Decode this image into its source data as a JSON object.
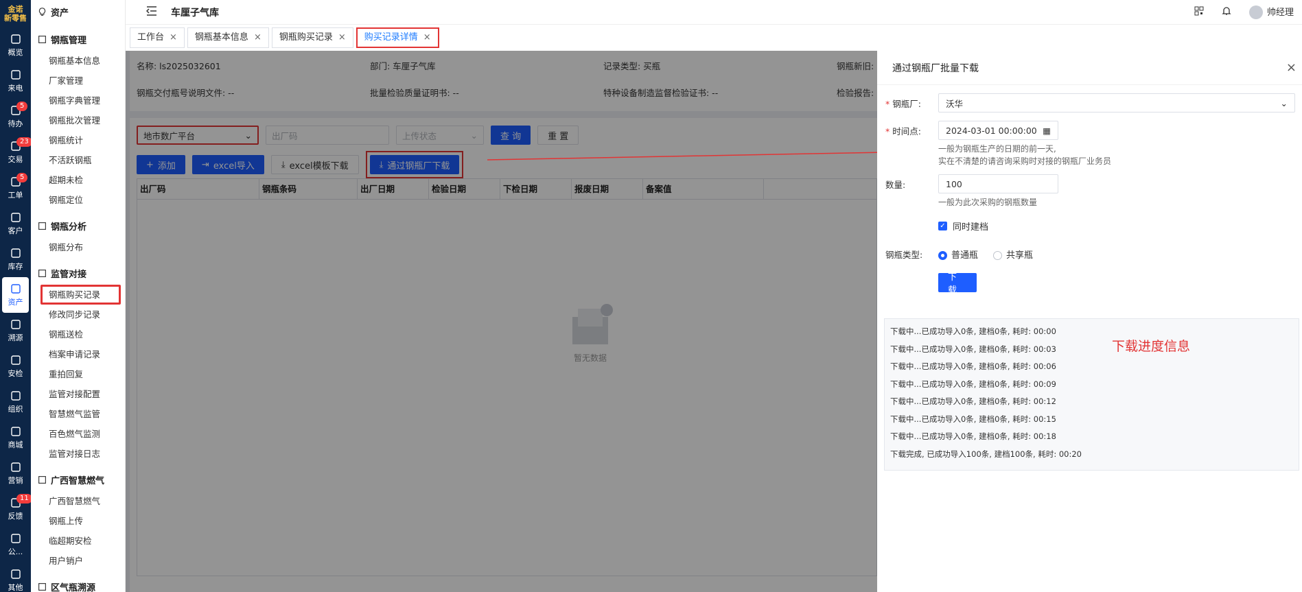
{
  "brand": {
    "line1": "金诺",
    "line2": "新零售"
  },
  "rail": [
    {
      "label": "概览",
      "icon": "chart-icon",
      "badge": ""
    },
    {
      "label": "来电",
      "icon": "phone-icon",
      "badge": ""
    },
    {
      "label": "待办",
      "icon": "todo-icon",
      "badge": "5"
    },
    {
      "label": "交易",
      "icon": "trade-icon",
      "badge": "23"
    },
    {
      "label": "工单",
      "icon": "ticket-icon",
      "badge": "5"
    },
    {
      "label": "客户",
      "icon": "customer-icon",
      "badge": ""
    },
    {
      "label": "库存",
      "icon": "inventory-icon",
      "badge": ""
    },
    {
      "label": "资产",
      "icon": "bulb-icon",
      "badge": "",
      "active": true
    },
    {
      "label": "溯源",
      "icon": "compass-icon",
      "badge": ""
    },
    {
      "label": "安检",
      "icon": "shield-icon",
      "badge": ""
    },
    {
      "label": "组织",
      "icon": "org-icon",
      "badge": ""
    },
    {
      "label": "商城",
      "icon": "shop-icon",
      "badge": ""
    },
    {
      "label": "营销",
      "icon": "trophy-icon",
      "badge": ""
    },
    {
      "label": "反馈",
      "icon": "feedback-icon",
      "badge": "11"
    },
    {
      "label": "公...",
      "icon": "megaphone-icon",
      "badge": ""
    },
    {
      "label": "其他",
      "icon": "grid-icon",
      "badge": ""
    }
  ],
  "sidebar": {
    "title": "资产",
    "sections": [
      {
        "title": "钢瓶管理",
        "items": [
          "钢瓶基本信息",
          "厂家管理",
          "钢瓶字典管理",
          "钢瓶批次管理",
          "钢瓶统计",
          "不活跃钢瓶",
          "超期未检",
          "钢瓶定位"
        ]
      },
      {
        "title": "钢瓶分析",
        "items": [
          "钢瓶分布"
        ]
      },
      {
        "title": "监管对接",
        "items": [
          "钢瓶购买记录",
          "修改同步记录",
          "钢瓶送检",
          "档案申请记录",
          "重拍回复",
          "监管对接配置",
          "智慧燃气监管",
          "百色燃气监测",
          "监管对接日志"
        ]
      },
      {
        "title": "广西智慧燃气",
        "items": [
          "广西智慧燃气",
          "钢瓶上传",
          "临超期安检",
          "用户销户"
        ]
      },
      {
        "title": "区气瓶溯源",
        "items": []
      }
    ]
  },
  "topbar": {
    "title": "车厘子气库",
    "user": "帅经理"
  },
  "tabs": [
    {
      "label": "工作台"
    },
    {
      "label": "钢瓶基本信息"
    },
    {
      "label": "钢瓶购买记录"
    },
    {
      "label": "购买记录详情",
      "active": true
    }
  ],
  "info": {
    "name": "名称: ls2025032601",
    "dept": "部门: 车厘子气库",
    "type": "记录类型: 买瓶",
    "new": "钢瓶新旧:",
    "file1": "钢瓶交付瓶号说明文件: --",
    "file2": "批量检验质量证明书: --",
    "file3": "特种设备制造监督检验证书: --",
    "file4": "检验报告:"
  },
  "filters": {
    "platform": "地市数广平台",
    "code_placeholder": "出厂码",
    "status_placeholder": "上传状态",
    "query": "查 询",
    "reset": "重 置"
  },
  "actions": {
    "add": "添加",
    "import": "excel导入",
    "template": "excel模板下载",
    "factory": "通过钢瓶厂下载"
  },
  "grid": {
    "columns": [
      "出厂码",
      "钢瓶条码",
      "出厂日期",
      "检验日期",
      "下检日期",
      "报废日期",
      "备案值"
    ],
    "empty": "暂无数据"
  },
  "drawer": {
    "title": "通过钢瓶厂批量下载",
    "factory_label": "钢瓶厂:",
    "factory_value": "沃华",
    "time_label": "时间点:",
    "time_value": "2024-03-01 00:00:00",
    "time_hint1": "一般为钢瓶生产的日期的前一天,",
    "time_hint2": "实在不清楚的请咨询采购时对接的钢瓶厂业务员",
    "qty_label": "数量:",
    "qty_value": "100",
    "qty_hint": "一般为此次采购的钢瓶数量",
    "archive_label": "同时建档",
    "type_label": "钢瓶类型:",
    "type_opt1": "普通瓶",
    "type_opt2": "共享瓶",
    "download": "下 载",
    "log": [
      "下载中...已成功导入0条, 建档0条, 耗时: 00:00",
      "下载中...已成功导入0条, 建档0条, 耗时: 00:03",
      "下载中...已成功导入0条, 建档0条, 耗时: 00:06",
      "下载中...已成功导入0条, 建档0条, 耗时: 00:09",
      "下载中...已成功导入0条, 建档0条, 耗时: 00:12",
      "下载中...已成功导入0条, 建档0条, 耗时: 00:15",
      "下载中...已成功导入0条, 建档0条, 耗时: 00:18",
      "下载完成, 已成功导入100条, 建档100条, 耗时: 00:20"
    ]
  },
  "annotation": "下载进度信息",
  "colors": {
    "primary": "#1e5eff",
    "danger": "#e23434",
    "rail": "#0d2647"
  }
}
